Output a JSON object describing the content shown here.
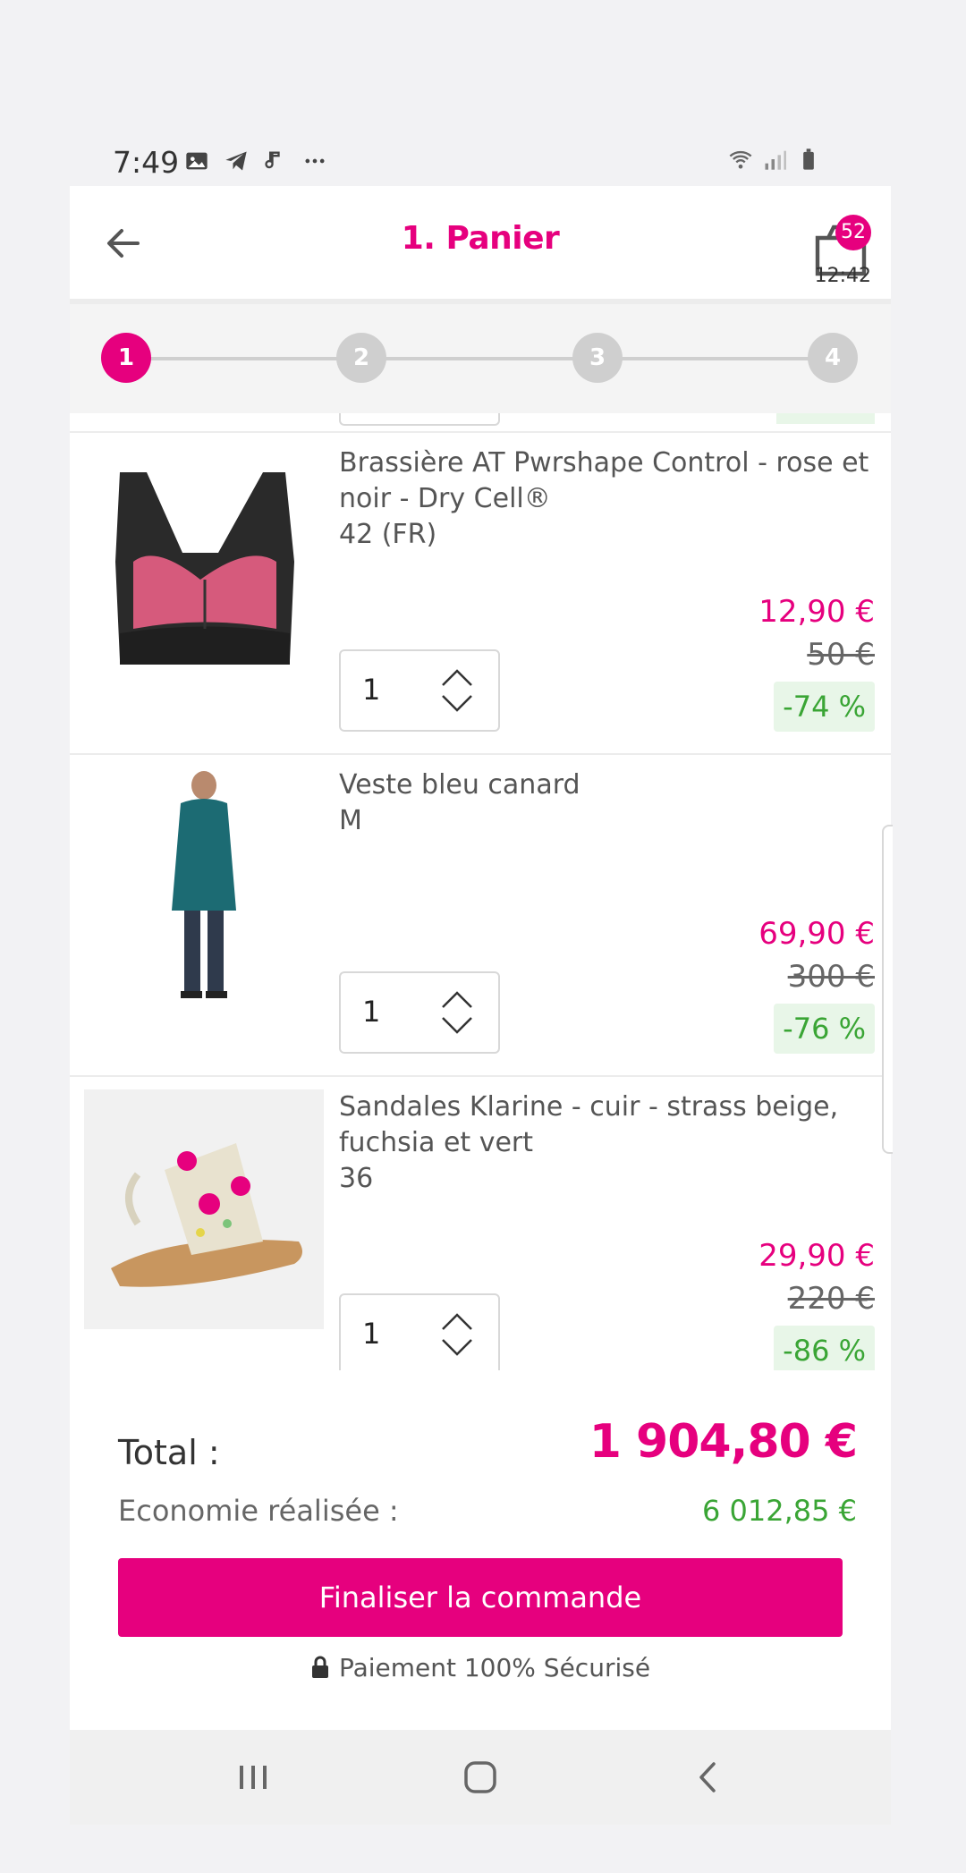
{
  "status_bar": {
    "time": "7:49",
    "left_icons": [
      "image-icon",
      "telegram-icon",
      "music-icon",
      "more-icon"
    ],
    "right_icons": [
      "wifi-icon",
      "signal-icon",
      "battery-icon"
    ]
  },
  "header": {
    "title": "1. Panier",
    "cart_badge": "52",
    "cart_timer": "12:42"
  },
  "stepper": {
    "steps": [
      "1",
      "2",
      "3",
      "4"
    ],
    "active_step": "1"
  },
  "items": [
    {
      "name": "Brassière AT Pwrshape Control - rose et noir - Dry Cell®",
      "size": "42 (FR)",
      "quantity": "1",
      "price": "12,90 €",
      "old_price": "50 €",
      "discount": "-74 %"
    },
    {
      "name": "Veste bleu canard",
      "size": "M",
      "quantity": "1",
      "price": "69,90 €",
      "old_price": "300 €",
      "discount": "-76 %"
    },
    {
      "name": "Sandales Klarine - cuir - strass beige, fuchsia et vert",
      "size": "36",
      "quantity": "1",
      "price": "29,90 €",
      "old_price": "220 €",
      "discount": "-86 %"
    }
  ],
  "summary": {
    "total_label": "Total :",
    "total_value": "1 904,80 €",
    "savings_label": "Economie réalisée :",
    "savings_value": "6 012,85 €",
    "checkout_label": "Finaliser la commande",
    "secure_label": "Paiement 100% Sécurisé"
  },
  "colors": {
    "brand": "#e6007e",
    "discount_green": "#3aa535",
    "step_inactive": "#cfcfcf"
  }
}
